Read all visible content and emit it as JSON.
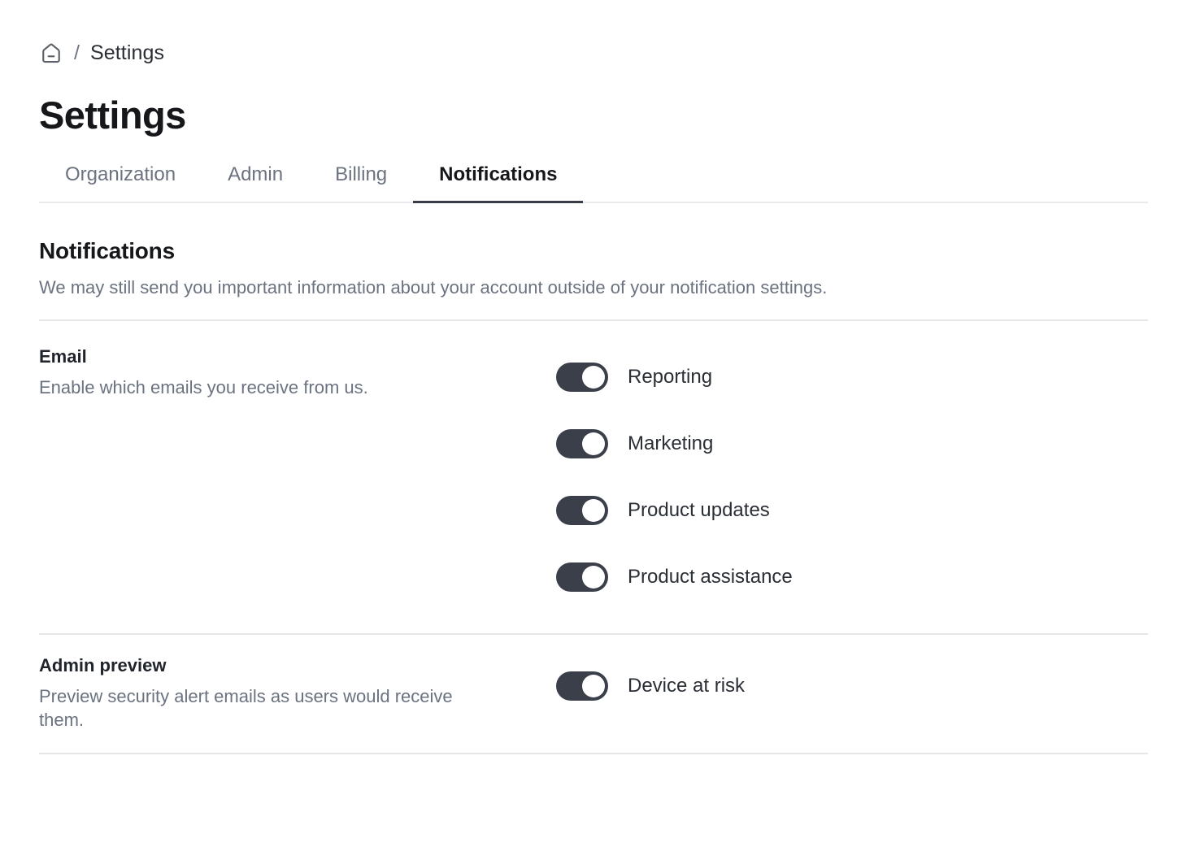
{
  "breadcrumb": {
    "home_icon": "home-icon",
    "separator": "/",
    "current": "Settings"
  },
  "header": {
    "title": "Settings"
  },
  "tabs": [
    {
      "label": "Organization",
      "active": false
    },
    {
      "label": "Admin",
      "active": false
    },
    {
      "label": "Billing",
      "active": false
    },
    {
      "label": "Notifications",
      "active": true
    }
  ],
  "section": {
    "title": "Notifications",
    "description": "We may still send you important information about your account outside of your notification settings."
  },
  "settings_groups": [
    {
      "title": "Email",
      "description": "Enable which emails you receive from us.",
      "toggles": [
        {
          "label": "Reporting",
          "on": true
        },
        {
          "label": "Marketing",
          "on": true
        },
        {
          "label": "Product updates",
          "on": true
        },
        {
          "label": "Product assistance",
          "on": true
        }
      ]
    },
    {
      "title": "Admin preview",
      "description": "Preview security alert emails as users would receive them.",
      "toggles": [
        {
          "label": "Device at risk",
          "on": true
        }
      ]
    }
  ],
  "colors": {
    "toggle_on": "#3a3f49",
    "text_primary": "#15171b",
    "text_muted": "#6b7280",
    "divider": "#e4e6e8",
    "active_tab_underline": "#383c47"
  }
}
